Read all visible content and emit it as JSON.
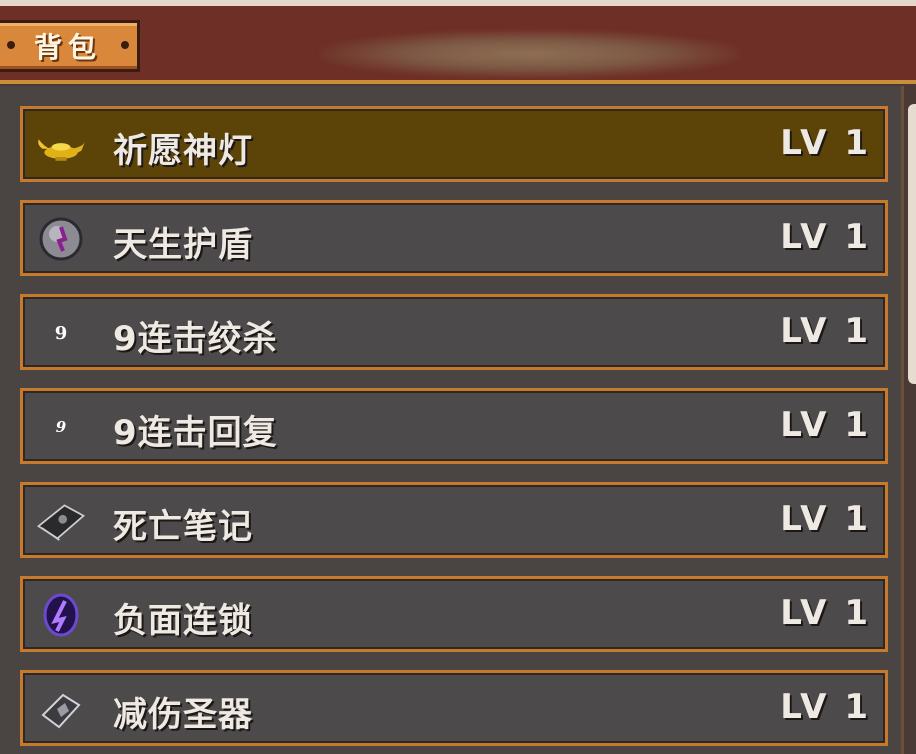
{
  "header": {
    "tab_label": "背包"
  },
  "items": [
    {
      "name": "祈愿神灯",
      "level": "LV 1",
      "icon": "magic-lamp-icon",
      "selected": true
    },
    {
      "name": "天生护盾",
      "level": "LV 1",
      "icon": "shield-orb-icon",
      "selected": false
    },
    {
      "name": "9连击绞杀",
      "level": "LV 1",
      "icon": "nine-combo-icon",
      "icon_text": "9",
      "selected": false
    },
    {
      "name": "9连击回复",
      "level": "LV 1",
      "icon": "nine-combo-heal-icon",
      "icon_text": "9",
      "selected": false
    },
    {
      "name": "死亡笔记",
      "level": "LV 1",
      "icon": "death-note-book-icon",
      "selected": false
    },
    {
      "name": "负面连锁",
      "level": "LV 1",
      "icon": "dark-chain-orb-icon",
      "selected": false
    },
    {
      "name": "减伤圣器",
      "level": "LV 1",
      "icon": "holy-relic-icon",
      "selected": false
    }
  ],
  "colors": {
    "header_bg": "#6e2f26",
    "tab_bg": "#d9873a",
    "item_border": "#c77a2c",
    "item_bg": "#4d4a4c",
    "item_selected_bg": "#5c4409",
    "text": "#eee9e2"
  }
}
